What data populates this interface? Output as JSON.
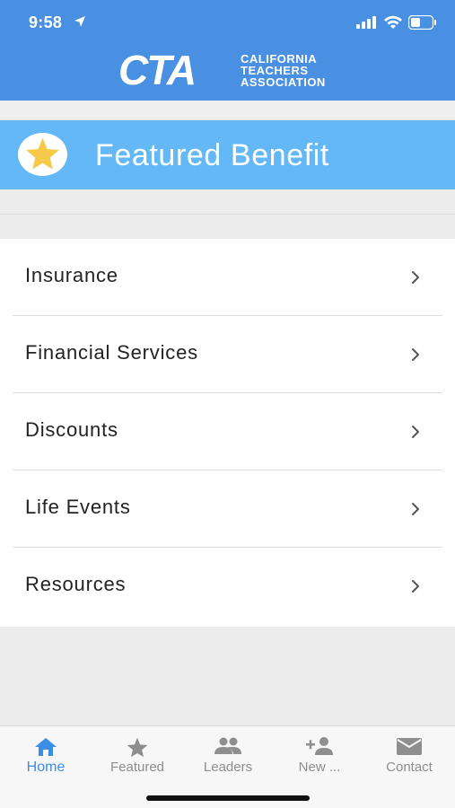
{
  "status_bar": {
    "time": "9:58",
    "icons": [
      "location-arrow-icon",
      "signal-bars-icon",
      "wifi-icon",
      "battery-icon"
    ]
  },
  "header": {
    "logo_text": "CTA",
    "logo_subtitle": [
      "CALIFORNIA",
      "TEACHERS",
      "ASSOCIATION"
    ],
    "background_color": "#4a90e2"
  },
  "featured": {
    "label": "Featured Benefit",
    "icon": "star-icon",
    "background_color": "#64b8f5",
    "star_color": "#f7c948"
  },
  "menu": {
    "items": [
      {
        "label": "Insurance",
        "icon": "chevron-right-icon"
      },
      {
        "label": "Financial Services",
        "icon": "chevron-right-icon"
      },
      {
        "label": "Discounts",
        "icon": "chevron-right-icon"
      },
      {
        "label": "Life Events",
        "icon": "chevron-right-icon"
      },
      {
        "label": "Resources",
        "icon": "chevron-right-icon"
      }
    ]
  },
  "tab_bar": {
    "active_color": "#3a8ee6",
    "inactive_color": "#8e8e8e",
    "tabs": [
      {
        "label": "Home",
        "icon": "home-icon",
        "active": true
      },
      {
        "label": "Featured",
        "icon": "star-icon",
        "active": false
      },
      {
        "label": "Leaders",
        "icon": "people-icon",
        "active": false
      },
      {
        "label": "New ...",
        "icon": "add-person-icon",
        "active": false
      },
      {
        "label": "Contact",
        "icon": "envelope-icon",
        "active": false
      }
    ]
  }
}
